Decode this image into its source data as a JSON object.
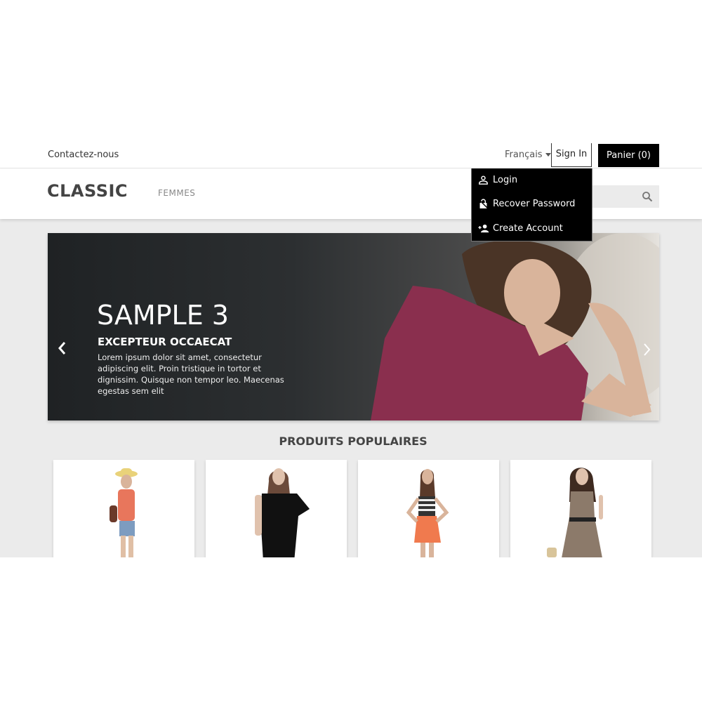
{
  "topbar": {
    "contact_label": "Contactez-nous",
    "language": "Français",
    "signin_label": "Sign In",
    "cart_label": "Panier (0)"
  },
  "header": {
    "logo": "CLASSIC",
    "nav": [
      {
        "label": "FEMMES"
      }
    ],
    "search_placeholder": ""
  },
  "user_menu": {
    "items": [
      {
        "label": "Login",
        "icon": "person-icon"
      },
      {
        "label": "Recover Password",
        "icon": "lock-icon"
      },
      {
        "label": "Create Account",
        "icon": "add-person-icon"
      }
    ]
  },
  "slider": {
    "title": "SAMPLE 3",
    "subtitle": "EXCEPTEUR OCCAECAT",
    "text": "Lorem ipsum dolor sit amet, consectetur adipiscing elit. Proin tristique in tortor et dignissim. Quisque non tempor leo. Maecenas egestas sem elit"
  },
  "products": {
    "title": "PRODUITS POPULAIRES",
    "items": [
      {
        "name": "product-1",
        "colors": {
          "top": "#e8765c",
          "bottom": "#7d9cc0",
          "accent": "#e9d27a"
        }
      },
      {
        "name": "product-2",
        "colors": {
          "top": "#111111",
          "bottom": "#111111",
          "accent": "#6b4a3a"
        }
      },
      {
        "name": "product-3",
        "colors": {
          "top": "#333333",
          "bottom": "#f07a4e",
          "accent": "#5a3a2a"
        }
      },
      {
        "name": "product-4",
        "colors": {
          "top": "#8c7a6a",
          "bottom": "#8c7a6a",
          "accent": "#3e2a20"
        }
      }
    ]
  },
  "colors": {
    "accent": "#000000",
    "background": "#ebebeb"
  }
}
